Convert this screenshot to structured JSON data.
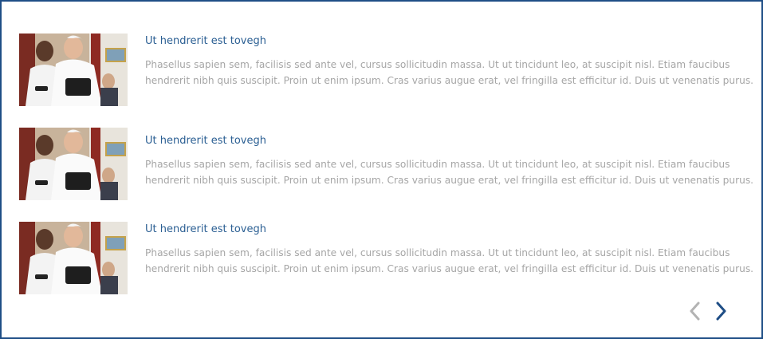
{
  "list": {
    "items": [
      {
        "title": "Ut hendrerit est tovegh",
        "body": "Phasellus sapien sem, facilisis sed ante vel, cursus sollicitudin massa. Ut ut tincidunt leo, at suscipit nisl. Etiam faucibus hendrerit nibh quis suscipit. Proin ut enim ipsum. Cras varius augue erat, vel fringilla est efficitur id. Duis ut venenatis purus."
      },
      {
        "title": "Ut hendrerit est tovegh",
        "body": "Phasellus sapien sem, facilisis sed ante vel, cursus sollicitudin massa. Ut ut tincidunt leo, at suscipit nisl. Etiam faucibus hendrerit nibh quis suscipit. Proin ut enim ipsum. Cras varius augue erat, vel fringilla est efficitur id. Duis ut venenatis purus."
      },
      {
        "title": "Ut hendrerit est tovegh",
        "body": "Phasellus sapien sem, facilisis sed ante vel, cursus sollicitudin massa. Ut ut tincidunt leo, at suscipit nisl. Etiam faucibus hendrerit nibh quis suscipit. Proin ut enim ipsum. Cras varius augue erat, vel fringilla est efficitur id. Duis ut venenatis purus."
      }
    ]
  },
  "pager": {
    "prev_icon": "chevron-left-icon",
    "next_icon": "chevron-right-icon",
    "prev_color": "#b3b3b3",
    "next_color": "#1f4e86"
  },
  "colors": {
    "border": "#1f4e86",
    "title": "#2b5f93",
    "body": "#a6a6a6"
  }
}
